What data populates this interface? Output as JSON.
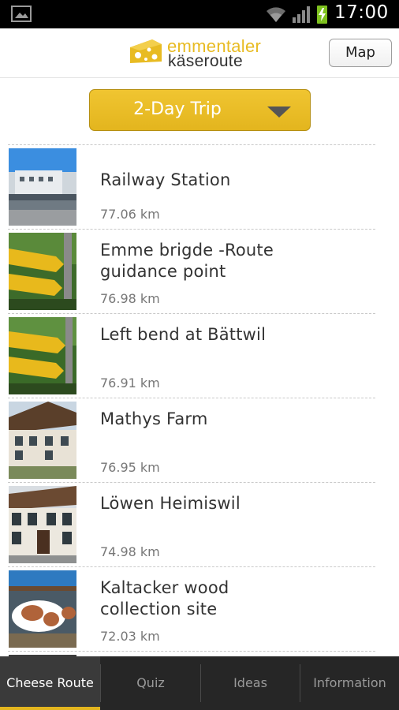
{
  "status_bar": {
    "time": "17:00",
    "icons": [
      "image-notification-icon",
      "wifi-icon",
      "signal-icon",
      "battery-charging-icon"
    ]
  },
  "header": {
    "logo_line1": "emmentaler",
    "logo_line2": "käseroute",
    "map_button": "Map"
  },
  "trip_selector": {
    "selected": "2-Day Trip"
  },
  "list": [
    {
      "title_lines": [
        "Railway Station"
      ],
      "distance": "77.06 km",
      "thumb": "railway-station-photo"
    },
    {
      "title_lines": [
        "Emme brigde -Route",
        "guidance point"
      ],
      "distance": "76.98 km",
      "thumb": "signpost-photo"
    },
    {
      "title_lines": [
        "Left bend at Bättwil"
      ],
      "distance": "76.91 km",
      "thumb": "signpost-photo"
    },
    {
      "title_lines": [
        "Mathys Farm"
      ],
      "distance": "76.95 km",
      "thumb": "farmhouse-photo"
    },
    {
      "title_lines": [
        "Löwen Heimiswil"
      ],
      "distance": "74.98 km",
      "thumb": "inn-photo"
    },
    {
      "title_lines": [
        "Kaltacker wood",
        "collection site"
      ],
      "distance": "72.03 km",
      "thumb": "cow-photo"
    }
  ],
  "tabs": [
    {
      "label": "Cheese Route",
      "active": true
    },
    {
      "label": "Quiz",
      "active": false
    },
    {
      "label": "Ideas",
      "active": false
    },
    {
      "label": "Information",
      "active": false
    }
  ],
  "colors": {
    "accent": "#e3b51e",
    "tabbar": "#262626",
    "statusbar": "#000000"
  }
}
